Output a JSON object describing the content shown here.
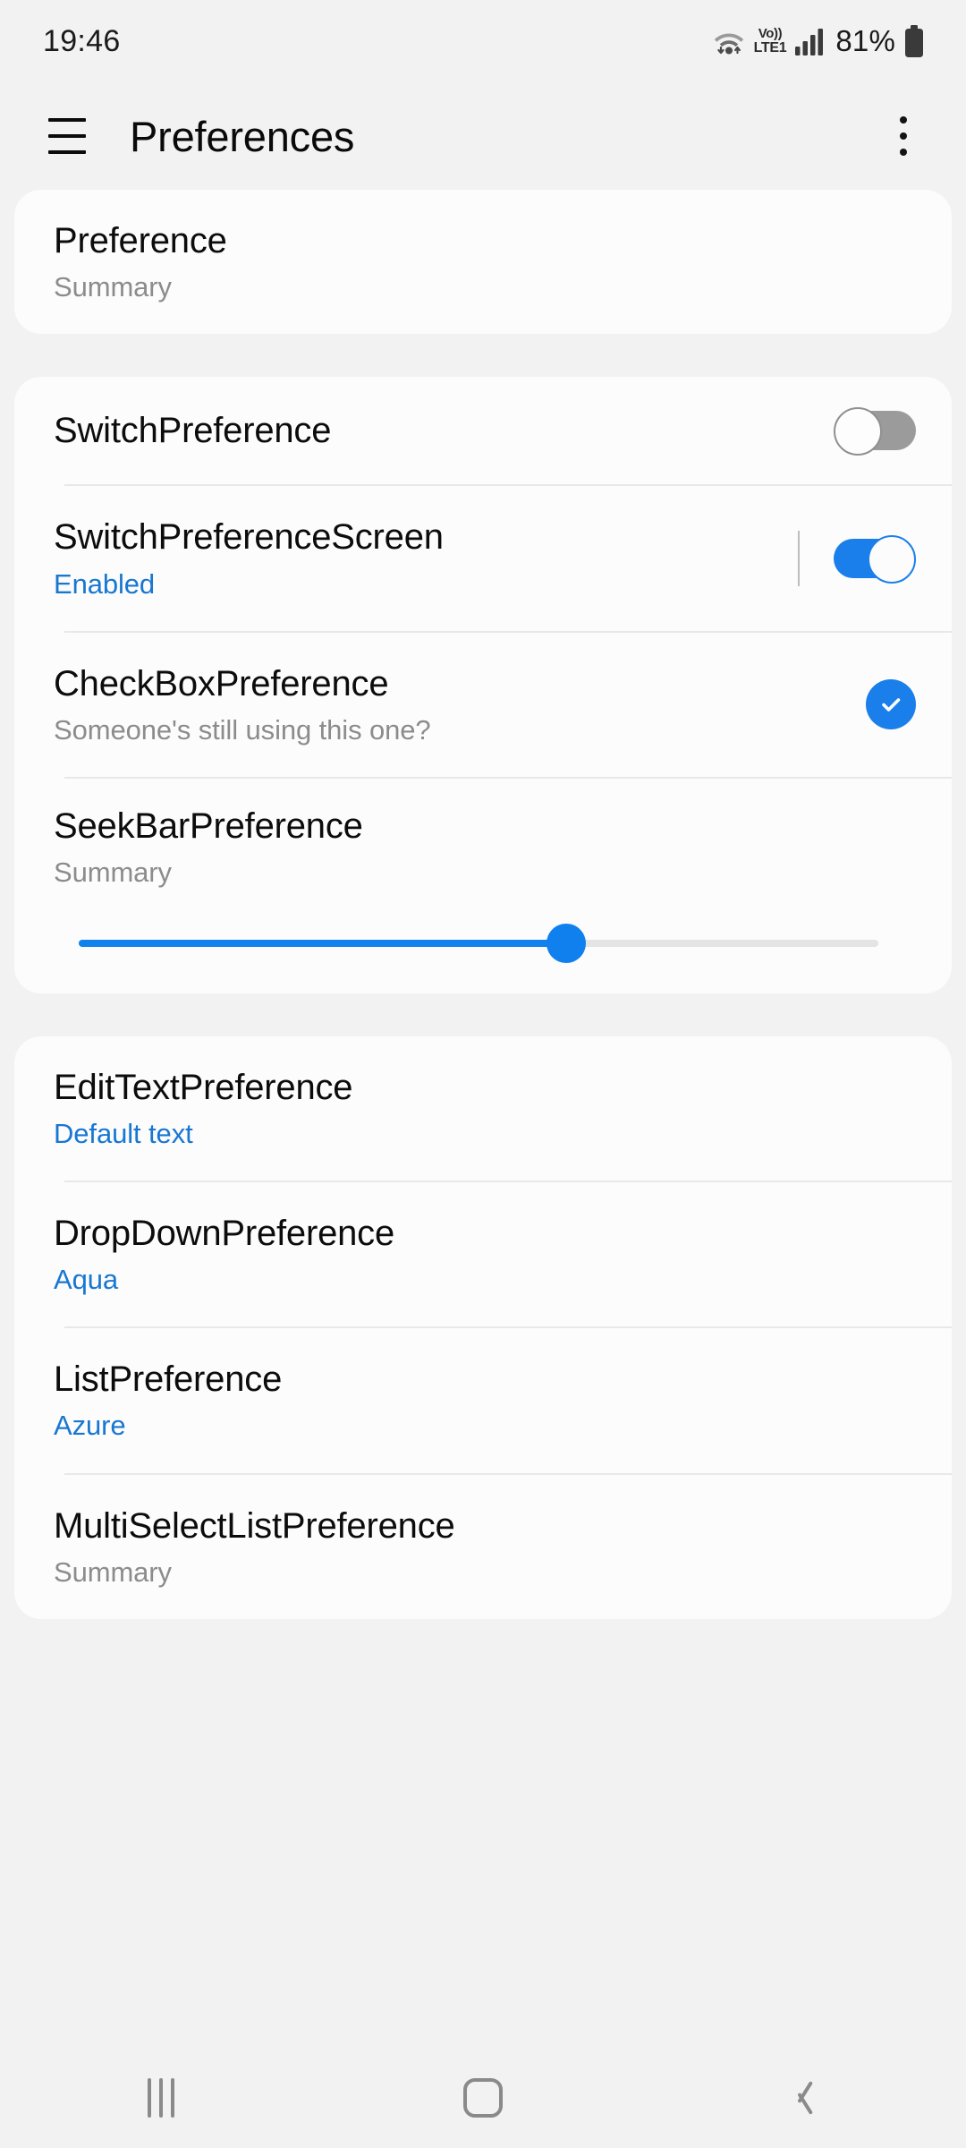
{
  "status_bar": {
    "time": "19:46",
    "wifi_icon": "wifi-icon",
    "volte_top": "Vo))",
    "volte_bottom": "LTE1",
    "signal_icon": "signal-bars-icon",
    "battery_percent": "81%",
    "battery_icon": "battery-icon"
  },
  "app_bar": {
    "menu_icon": "hamburger-menu-icon",
    "title": "Preferences",
    "overflow_icon": "more-options-icon"
  },
  "colors": {
    "accent_blue": "#1A7FEB",
    "summary_blue": "#1877D2",
    "summary_gray": "#8C8C8C",
    "page_background": "#F2F2F2",
    "card_background": "#FCFCFC",
    "divider": "#E8E8E8",
    "switch_off_track": "#9B9B9B"
  },
  "groups": [
    {
      "items": [
        {
          "title": "Preference",
          "summary": "Summary",
          "summary_style": "gray",
          "widget": "none"
        }
      ]
    },
    {
      "items": [
        {
          "title": "SwitchPreference",
          "summary": "",
          "summary_style": "none",
          "widget": "switch",
          "switch_state": "off"
        },
        {
          "title": "SwitchPreferenceScreen",
          "summary": "Enabled",
          "summary_style": "blue",
          "widget": "switch",
          "switch_state": "on"
        },
        {
          "title": "CheckBoxPreference",
          "summary": "Someone's still using this one?",
          "summary_style": "gray",
          "widget": "checkbox",
          "checkbox_state": "checked"
        },
        {
          "title": "SeekBarPreference",
          "summary": "Summary",
          "summary_style": "gray",
          "widget": "seekbar",
          "seek_percent": 61
        }
      ]
    },
    {
      "items": [
        {
          "title": "EditTextPreference",
          "summary": "Default text",
          "summary_style": "blue",
          "widget": "none"
        },
        {
          "title": "DropDownPreference",
          "summary": "Aqua",
          "summary_style": "blue",
          "widget": "none"
        },
        {
          "title": "ListPreference",
          "summary": "Azure",
          "summary_style": "blue",
          "widget": "none"
        },
        {
          "title": "MultiSelectListPreference",
          "summary": "Summary",
          "summary_style": "gray",
          "widget": "none"
        }
      ]
    }
  ],
  "nav_bar": {
    "recents_label": "recents-icon",
    "home_label": "home-icon",
    "back_label": "back-icon"
  }
}
